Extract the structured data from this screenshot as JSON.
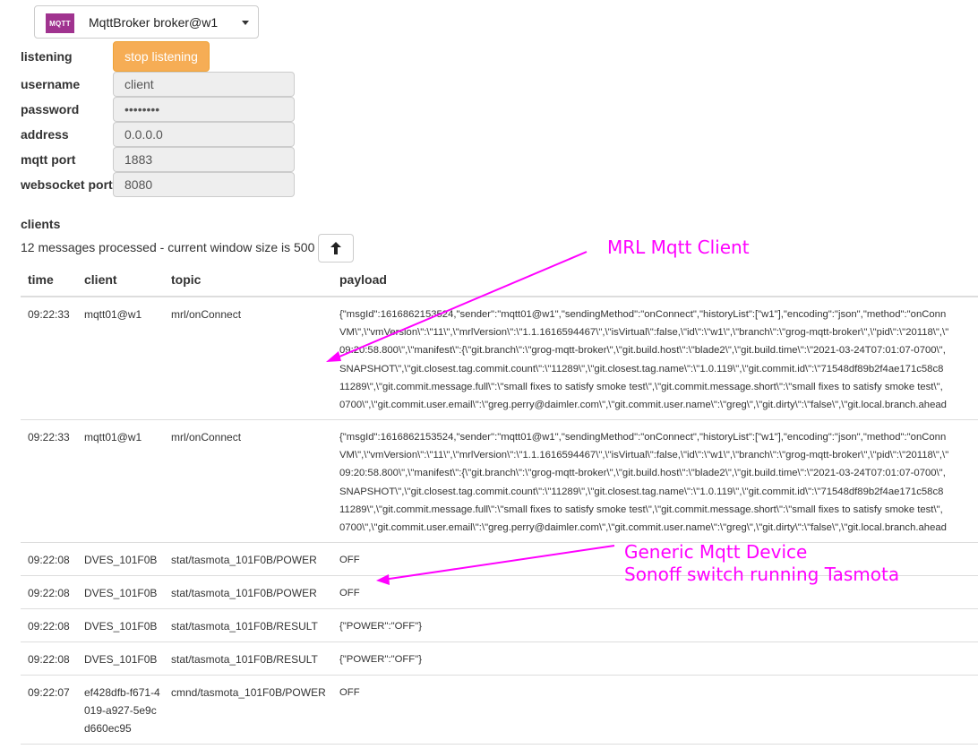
{
  "service_selector": {
    "logo_text": "MQTT",
    "name": "MqttBroker  broker@w1"
  },
  "form": {
    "listening_label": "listening",
    "stop_button": "stop listening",
    "username_label": "username",
    "username_value": "client",
    "password_label": "password",
    "password_value": "••••••••",
    "address_label": "address",
    "address_value": "0.0.0.0",
    "mqtt_port_label": "mqtt port",
    "mqtt_port_value": "1883",
    "websocket_port_label": "websocket port",
    "websocket_port_value": "8080"
  },
  "clients": {
    "title": "clients",
    "status": "12 messages processed - current window size is 500"
  },
  "table": {
    "headers": [
      "time",
      "client",
      "topic",
      "payload"
    ],
    "rows": [
      {
        "time": "09:22:33",
        "client": "mqtt01@w1",
        "topic": "mrl/onConnect",
        "payload_lines": [
          "{\"msgId\":1616862153524,\"sender\":\"mqtt01@w1\",\"sendingMethod\":\"onConnect\",\"historyList\":[\"w1\"],\"encoding\":\"json\",\"method\":\"onConn",
          "VM\\\",\\\"vmVersion\\\":\\\"11\\\",\\\"mrlVersion\\\":\\\"1.1.1616594467\\\",\\\"isVirtual\\\":false,\\\"id\\\":\\\"w1\\\",\\\"branch\\\":\\\"grog-mqtt-broker\\\",\\\"pid\\\":\\\"20118\\\",\\\"",
          "09:20:58.800\\\",\\\"manifest\\\":{\\\"git.branch\\\":\\\"grog-mqtt-broker\\\",\\\"git.build.host\\\":\\\"blade2\\\",\\\"git.build.time\\\":\\\"2021-03-24T07:01:07-0700\\\",",
          "SNAPSHOT\\\",\\\"git.closest.tag.commit.count\\\":\\\"11289\\\",\\\"git.closest.tag.name\\\":\\\"1.0.119\\\",\\\"git.commit.id\\\":\\\"71548df89b2f4ae171c58c8",
          "11289\\\",\\\"git.commit.message.full\\\":\\\"small fixes to satisfy smoke test\\\",\\\"git.commit.message.short\\\":\\\"small fixes to satisfy smoke test\\\",",
          "0700\\\",\\\"git.commit.user.email\\\":\\\"greg.perry@daimler.com\\\",\\\"git.commit.user.name\\\":\\\"greg\\\",\\\"git.dirty\\\":\\\"false\\\",\\\"git.local.branch.ahead"
        ]
      },
      {
        "time": "09:22:33",
        "client": "mqtt01@w1",
        "topic": "mrl/onConnect",
        "payload_lines": [
          "{\"msgId\":1616862153524,\"sender\":\"mqtt01@w1\",\"sendingMethod\":\"onConnect\",\"historyList\":[\"w1\"],\"encoding\":\"json\",\"method\":\"onConn",
          "VM\\\",\\\"vmVersion\\\":\\\"11\\\",\\\"mrlVersion\\\":\\\"1.1.1616594467\\\",\\\"isVirtual\\\":false,\\\"id\\\":\\\"w1\\\",\\\"branch\\\":\\\"grog-mqtt-broker\\\",\\\"pid\\\":\\\"20118\\\",\\\"",
          "09:20:58.800\\\",\\\"manifest\\\":{\\\"git.branch\\\":\\\"grog-mqtt-broker\\\",\\\"git.build.host\\\":\\\"blade2\\\",\\\"git.build.time\\\":\\\"2021-03-24T07:01:07-0700\\\",",
          "SNAPSHOT\\\",\\\"git.closest.tag.commit.count\\\":\\\"11289\\\",\\\"git.closest.tag.name\\\":\\\"1.0.119\\\",\\\"git.commit.id\\\":\\\"71548df89b2f4ae171c58c8",
          "11289\\\",\\\"git.commit.message.full\\\":\\\"small fixes to satisfy smoke test\\\",\\\"git.commit.message.short\\\":\\\"small fixes to satisfy smoke test\\\",",
          "0700\\\",\\\"git.commit.user.email\\\":\\\"greg.perry@daimler.com\\\",\\\"git.commit.user.name\\\":\\\"greg\\\",\\\"git.dirty\\\":\\\"false\\\",\\\"git.local.branch.ahead"
        ]
      },
      {
        "time": "09:22:08",
        "client": "DVES_101F0B",
        "topic": "stat/tasmota_101F0B/POWER",
        "payload_lines": [
          "OFF"
        ]
      },
      {
        "time": "09:22:08",
        "client": "DVES_101F0B",
        "topic": "stat/tasmota_101F0B/POWER",
        "payload_lines": [
          "OFF"
        ]
      },
      {
        "time": "09:22:08",
        "client": "DVES_101F0B",
        "topic": "stat/tasmota_101F0B/RESULT",
        "payload_lines": [
          "{\"POWER\":\"OFF\"}"
        ]
      },
      {
        "time": "09:22:08",
        "client": "DVES_101F0B",
        "topic": "stat/tasmota_101F0B/RESULT",
        "payload_lines": [
          "{\"POWER\":\"OFF\"}"
        ]
      },
      {
        "time": "09:22:07",
        "client": "ef428dfb-f671-4019-a927-5e9cd660ec95",
        "topic": "cmnd/tasmota_101F0B/POWER",
        "payload_lines": [
          "OFF"
        ]
      }
    ]
  },
  "annotations": {
    "mrl_client": "MRL Mqtt Client",
    "generic_line1": "Generic Mqtt Device",
    "generic_line2": "Sonoff switch running Tasmota",
    "color": "#ff00ff"
  }
}
